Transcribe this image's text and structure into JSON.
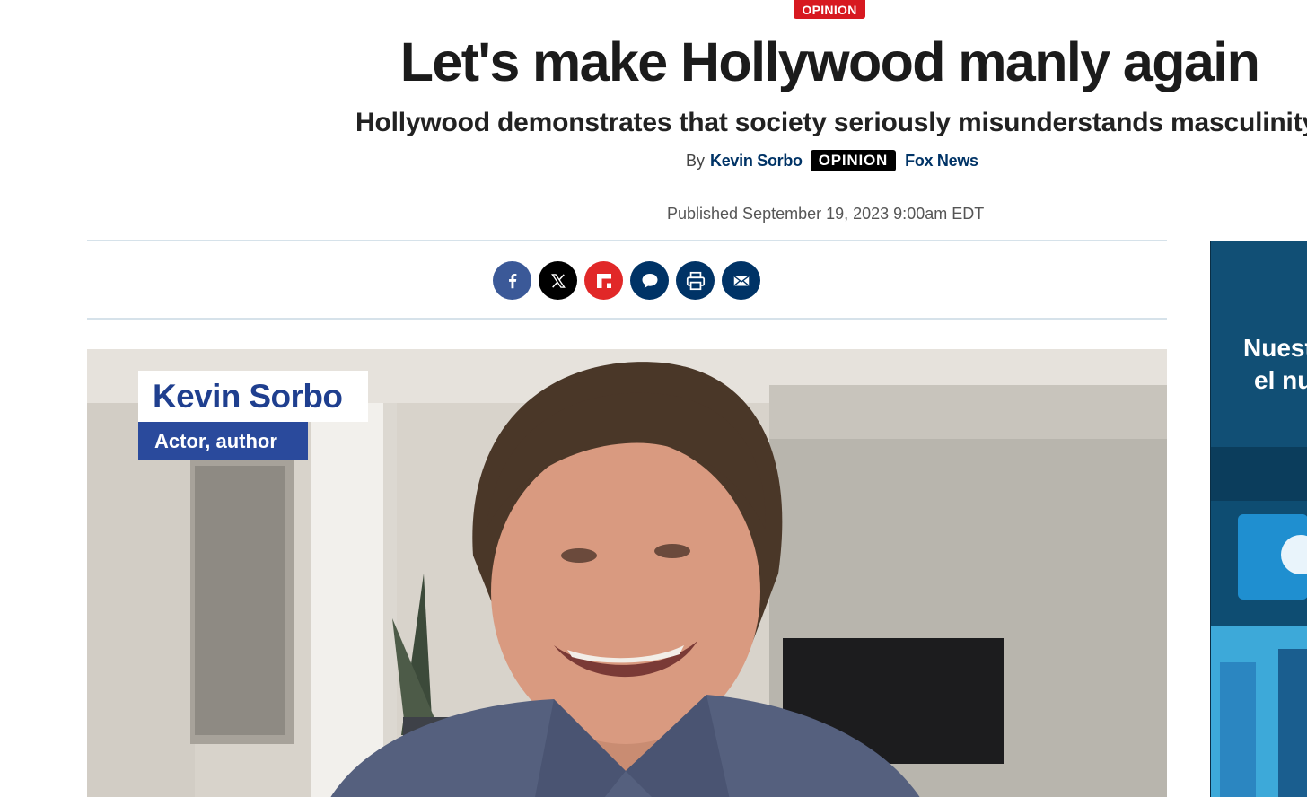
{
  "article": {
    "section_label": "OPINION",
    "headline": "Let's make Hollywood manly again",
    "subheadline": "Hollywood demonstrates that society seriously misunderstands masculinity",
    "byline_prefix": "By",
    "author": "Kevin Sorbo",
    "byline_tag": "OPINION",
    "outlet": "Fox News",
    "published": "Published September 19, 2023 9:00am EDT"
  },
  "share": {
    "buttons": [
      {
        "name": "facebook",
        "icon": "facebook-icon",
        "color": "#3b5998"
      },
      {
        "name": "x",
        "icon": "x-icon",
        "color": "#000000"
      },
      {
        "name": "flipboard",
        "icon": "flipboard-icon",
        "color": "#e12828"
      },
      {
        "name": "comments",
        "icon": "comment-icon",
        "color": "#003366"
      },
      {
        "name": "print",
        "icon": "print-icon",
        "color": "#003366"
      },
      {
        "name": "email",
        "icon": "email-icon",
        "color": "#003366"
      }
    ]
  },
  "media": {
    "lower_third_name": "Kevin Sorbo",
    "lower_third_title": "Actor, author"
  },
  "ad": {
    "line1": "Nuest",
    "line2": "el nu"
  },
  "colors": {
    "accent_red": "#d71920",
    "link_navy": "#003366",
    "lower_third_blue": "#2a4a9c"
  }
}
